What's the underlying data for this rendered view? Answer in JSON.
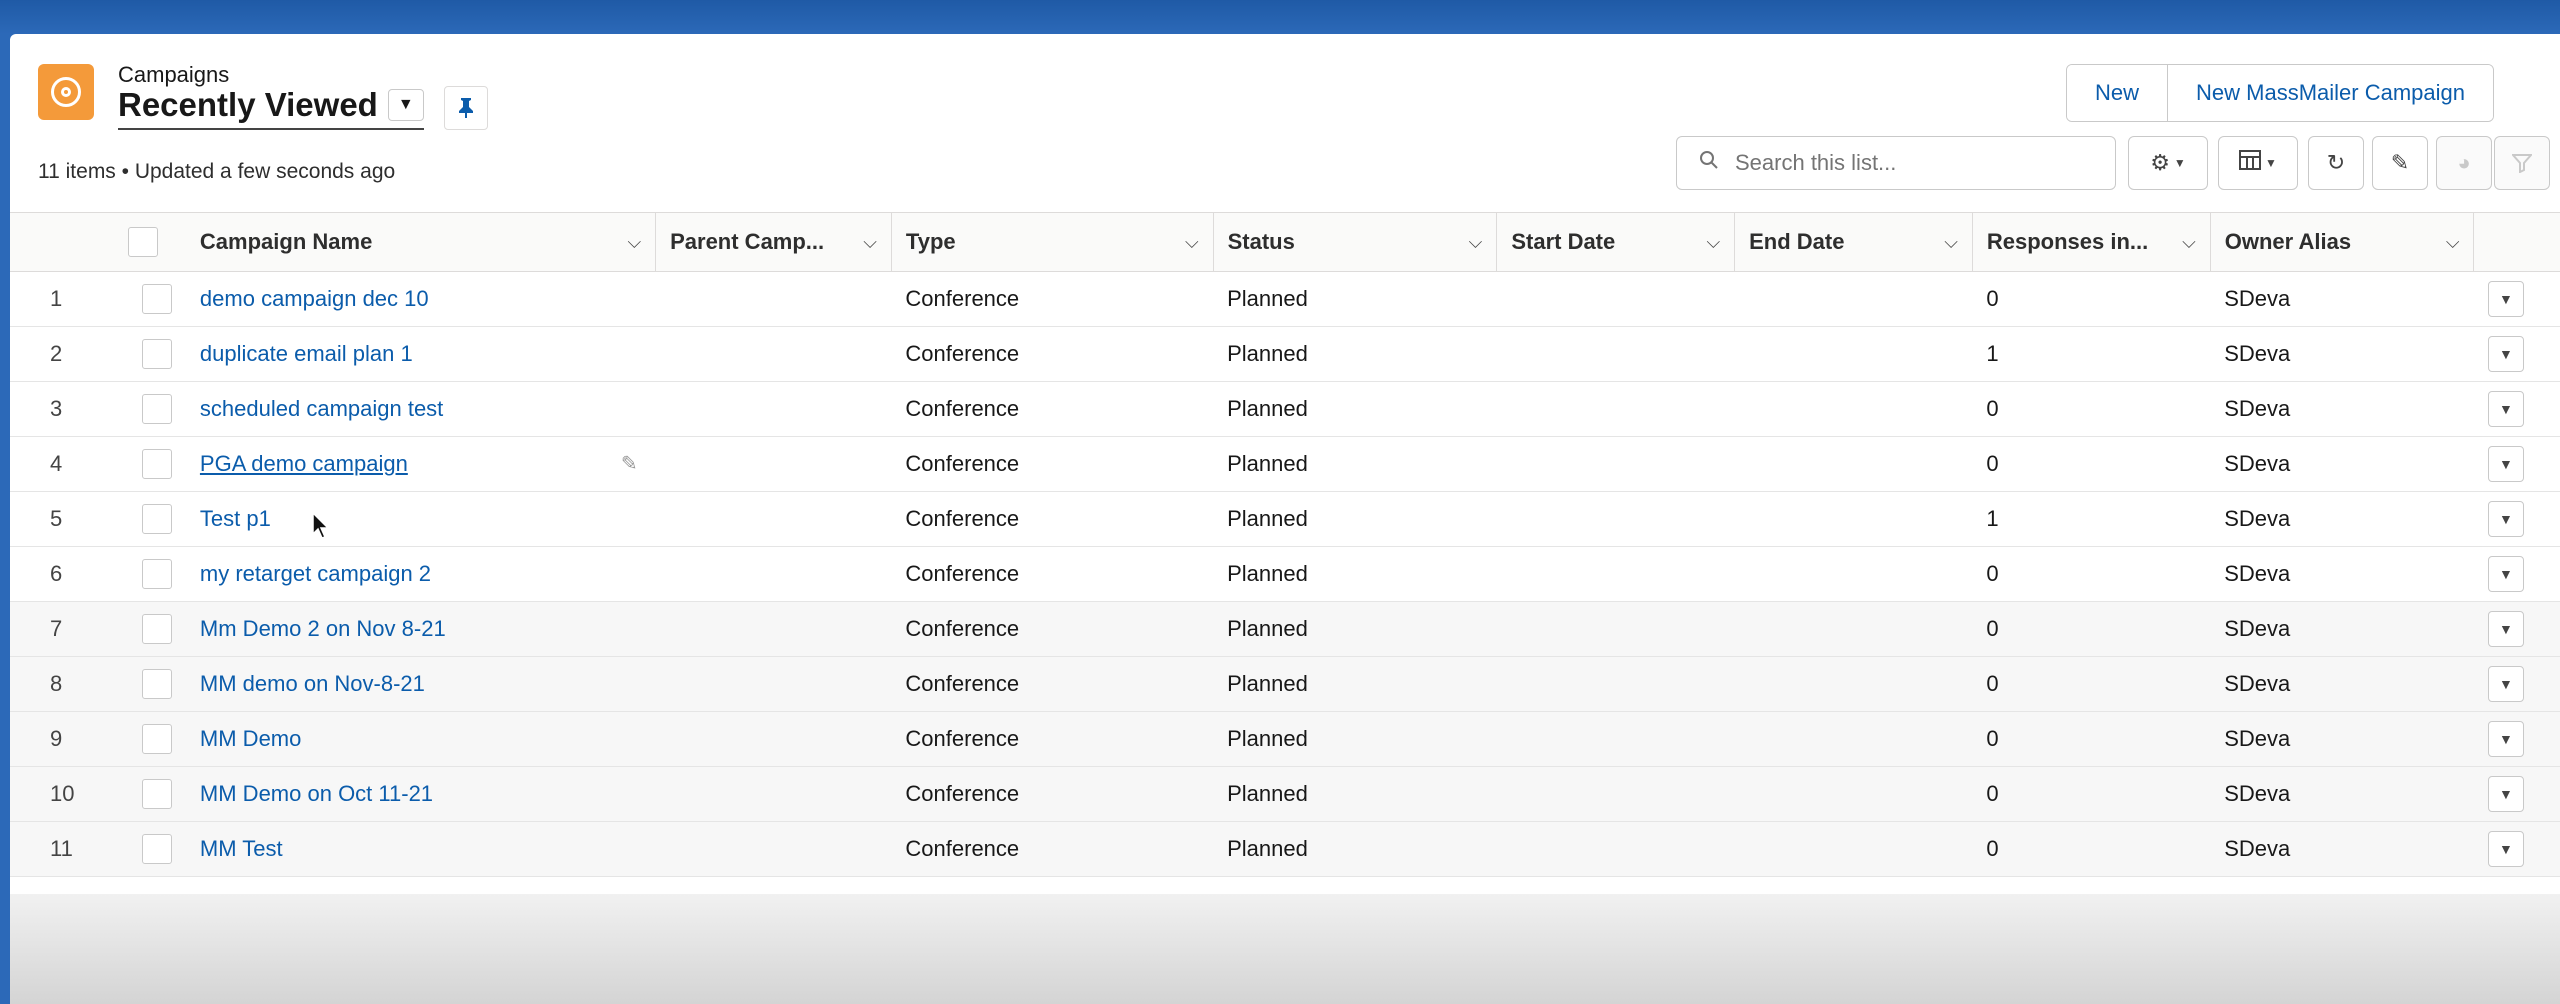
{
  "header": {
    "object_label": "Campaigns",
    "list_view_title": "Recently Viewed",
    "meta": "11 items • Updated a few seconds ago",
    "buttons": {
      "new": "New",
      "new_massmailer": "New MassMailer Campaign"
    },
    "search_placeholder": "Search this list...",
    "icons": {
      "app": "campaign-target-icon",
      "pin": "pin-icon",
      "settings": "gear-icon",
      "display": "table-display-icon",
      "refresh": "refresh-icon",
      "edit": "pencil-icon",
      "charts": "pie-chart-icon",
      "filter": "filter-icon"
    },
    "accent_color": "#0b5cab",
    "icon_color": "#f49a3a"
  },
  "columns": [
    "Campaign Name",
    "Parent Camp...",
    "Type",
    "Status",
    "Start Date",
    "End Date",
    "Responses in...",
    "Owner Alias"
  ],
  "rows": [
    {
      "num": "1",
      "name": "demo campaign dec 10",
      "parent": "",
      "type": "Conference",
      "status": "Planned",
      "start": "",
      "end": "",
      "responses": "0",
      "owner": "SDeva"
    },
    {
      "num": "2",
      "name": "duplicate email plan 1",
      "parent": "",
      "type": "Conference",
      "status": "Planned",
      "start": "",
      "end": "",
      "responses": "1",
      "owner": "SDeva"
    },
    {
      "num": "3",
      "name": "scheduled campaign test",
      "parent": "",
      "type": "Conference",
      "status": "Planned",
      "start": "",
      "end": "",
      "responses": "0",
      "owner": "SDeva"
    },
    {
      "num": "4",
      "name": "PGA demo campaign",
      "parent": "",
      "type": "Conference",
      "status": "Planned",
      "start": "",
      "end": "",
      "responses": "0",
      "owner": "SDeva"
    },
    {
      "num": "5",
      "name": "Test p1",
      "parent": "",
      "type": "Conference",
      "status": "Planned",
      "start": "",
      "end": "",
      "responses": "1",
      "owner": "SDeva"
    },
    {
      "num": "6",
      "name": "my retarget campaign 2",
      "parent": "",
      "type": "Conference",
      "status": "Planned",
      "start": "",
      "end": "",
      "responses": "0",
      "owner": "SDeva"
    },
    {
      "num": "7",
      "name": "Mm Demo 2 on Nov 8-21",
      "parent": "",
      "type": "Conference",
      "status": "Planned",
      "start": "",
      "end": "",
      "responses": "0",
      "owner": "SDeva"
    },
    {
      "num": "8",
      "name": "MM demo on Nov-8-21",
      "parent": "",
      "type": "Conference",
      "status": "Planned",
      "start": "",
      "end": "",
      "responses": "0",
      "owner": "SDeva"
    },
    {
      "num": "9",
      "name": "MM Demo",
      "parent": "",
      "type": "Conference",
      "status": "Planned",
      "start": "",
      "end": "",
      "responses": "0",
      "owner": "SDeva"
    },
    {
      "num": "10",
      "name": "MM Demo on Oct 11-21",
      "parent": "",
      "type": "Conference",
      "status": "Planned",
      "start": "",
      "end": "",
      "responses": "0",
      "owner": "SDeva"
    },
    {
      "num": "11",
      "name": "MM Test",
      "parent": "",
      "type": "Conference",
      "status": "Planned",
      "start": "",
      "end": "",
      "responses": "0",
      "owner": "SDeva"
    }
  ]
}
